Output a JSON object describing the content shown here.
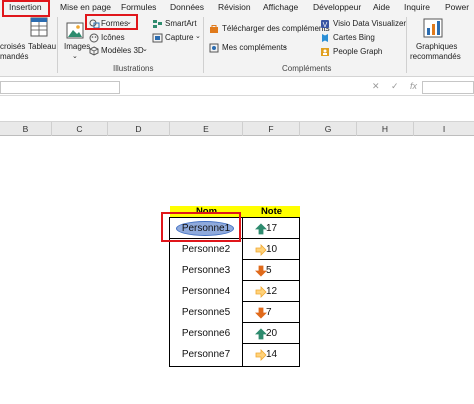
{
  "tabs": [
    "Insertion",
    "Mise en page",
    "Formules",
    "Données",
    "Révision",
    "Affichage",
    "Développeur",
    "Aide",
    "Inquire",
    "Power"
  ],
  "ribbon": {
    "partial_left_1": "croisés",
    "partial_left_2": "mandés",
    "tableau": "Tableau",
    "images": "Images",
    "formes": "Formes",
    "icones": "Icônes",
    "modeles3d": "Modèles 3D",
    "smartart": "SmartArt",
    "capture": "Capture",
    "illustrations_group": "Illustrations",
    "telecharger": "Télécharger des compléments",
    "mes_complements": "Mes compléments",
    "visio": "Visio Data Visualizer",
    "bing": "Cartes Bing",
    "people": "People Graph",
    "complements_group": "Compléments",
    "graphiques_1": "Graphiques",
    "graphiques_2": "recommandés"
  },
  "formula_bar": {
    "cancel": "✕",
    "enter": "✓",
    "fx": "fx"
  },
  "columns": [
    "B",
    "C",
    "D",
    "E",
    "F",
    "G",
    "H",
    "I"
  ],
  "table": {
    "headers": [
      "Nom",
      "Note"
    ],
    "rows": [
      {
        "name": "Personne1",
        "note": "17",
        "arrow": "up",
        "color": "#2e8b6e"
      },
      {
        "name": "Personne2",
        "note": "10",
        "arrow": "right",
        "color": "#f0a830"
      },
      {
        "name": "Personne3",
        "note": "5",
        "arrow": "down",
        "color": "#e06a1b"
      },
      {
        "name": "Personne4",
        "note": "12",
        "arrow": "right",
        "color": "#f0a830"
      },
      {
        "name": "Personne5",
        "note": "7",
        "arrow": "down",
        "color": "#e06a1b"
      },
      {
        "name": "Personne6",
        "note": "20",
        "arrow": "up",
        "color": "#2e8b6e"
      },
      {
        "name": "Personne7",
        "note": "14",
        "arrow": "right",
        "color": "#f0a830"
      }
    ]
  },
  "colors": {
    "highlight_red": "#e0161b",
    "header_yellow": "#ffff00",
    "oval_fill": "#8faadc"
  }
}
